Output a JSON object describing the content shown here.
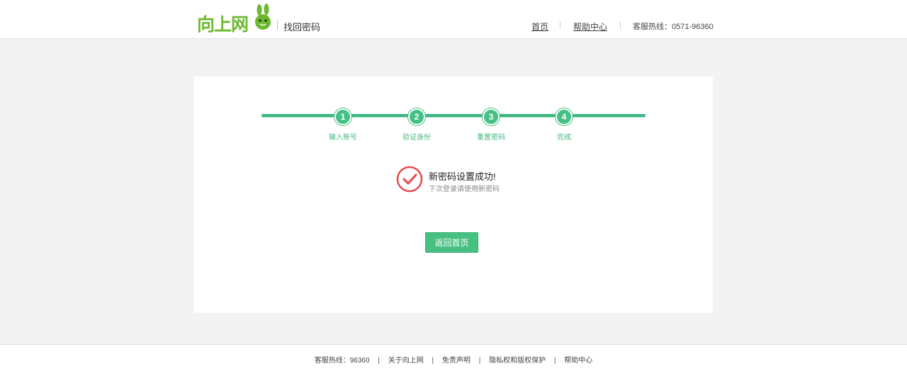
{
  "header": {
    "logo_text": "向上网",
    "page_name": "找回密码",
    "nav": [
      "首页",
      "帮助中心"
    ],
    "hotline": "客服热线：0571-96360"
  },
  "steps": [
    {
      "num": "1",
      "label": "输入账号"
    },
    {
      "num": "2",
      "label": "验证身份"
    },
    {
      "num": "3",
      "label": "重置密码"
    },
    {
      "num": "4",
      "label": "完成"
    }
  ],
  "result": {
    "title": "新密码设置成功!",
    "subtitle": "下次登录请使用新密码",
    "button": "返回首页"
  },
  "footer": {
    "hotline": "客服热线：96360",
    "links": [
      "关于向上网",
      "免责声明",
      "隐私权和版权保护",
      "帮助中心"
    ]
  },
  "colors": {
    "brand_green": "#6cb92f",
    "step_green": "#46c186",
    "success_red": "#e8484c"
  }
}
